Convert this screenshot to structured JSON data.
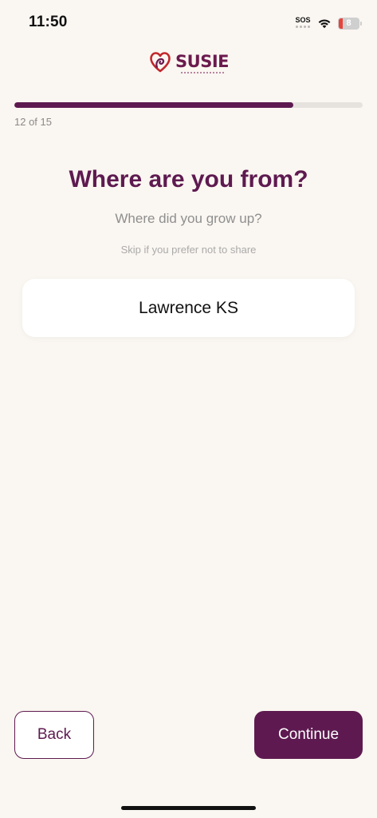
{
  "status_bar": {
    "time": "11:50",
    "sos_label": "SOS",
    "battery_level": "8",
    "battery_color": "#e5443b"
  },
  "logo": {
    "text": "SUSIE",
    "icon": "heart-logo-icon",
    "brand_color": "#6B1A4E"
  },
  "progress": {
    "text": "12 of 15",
    "current": 12,
    "total": 15,
    "fraction": 0.8
  },
  "question": {
    "title": "Where are you from?",
    "subtitle": "Where did you grow up?",
    "hint": "Skip if you prefer not to share"
  },
  "input": {
    "value": "Lawrence KS",
    "placeholder": ""
  },
  "buttons": {
    "back_label": "Back",
    "continue_label": "Continue"
  },
  "colors": {
    "accent": "#5E1A50",
    "background": "#FAF6F1"
  }
}
